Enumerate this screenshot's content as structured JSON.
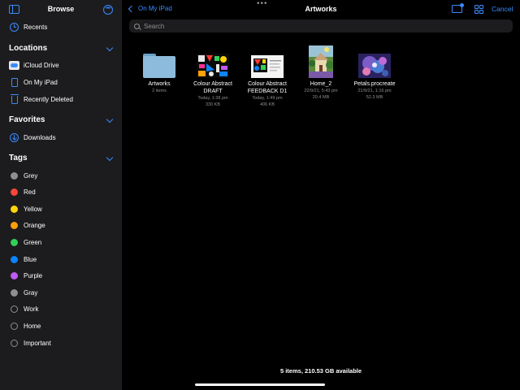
{
  "sidebar": {
    "title": "Browse",
    "recents": "Recents",
    "locations": {
      "header": "Locations",
      "items": [
        {
          "label": "iCloud Drive",
          "icon": "icloud-icon"
        },
        {
          "label": "On My iPad",
          "icon": "ipad-icon"
        },
        {
          "label": "Recently Deleted",
          "icon": "trash-icon"
        }
      ]
    },
    "favorites": {
      "header": "Favorites",
      "items": [
        {
          "label": "Downloads",
          "icon": "download-icon"
        }
      ]
    },
    "tags": {
      "header": "Tags",
      "items": [
        {
          "label": "Grey",
          "color": "#8e8e93"
        },
        {
          "label": "Red",
          "color": "#ff453a"
        },
        {
          "label": "Yellow",
          "color": "#ffd60a"
        },
        {
          "label": "Orange",
          "color": "#ff9f0a"
        },
        {
          "label": "Green",
          "color": "#30d158"
        },
        {
          "label": "Blue",
          "color": "#0a84ff"
        },
        {
          "label": "Purple",
          "color": "#bf5af2"
        },
        {
          "label": "Gray",
          "color": "#8e8e93"
        },
        {
          "label": "Work",
          "color": ""
        },
        {
          "label": "Home",
          "color": ""
        },
        {
          "label": "Important",
          "color": ""
        }
      ]
    }
  },
  "main": {
    "back_label": "On My iPad",
    "title": "Artworks",
    "cancel_label": "Cancel",
    "search_placeholder": "Search",
    "files": [
      {
        "name_line1": "Artworks",
        "name_line2": "",
        "meta1": "2 items",
        "meta2": "",
        "kind": "folder"
      },
      {
        "name_line1": "Colour Abstract",
        "name_line2": "DRAFT",
        "meta1": "Today, 1:38 pm",
        "meta2": "330 KB",
        "kind": "abstract-draft"
      },
      {
        "name_line1": "Colour Abstract",
        "name_line2": "FEEDBACK D1",
        "meta1": "Today, 1:49 pm",
        "meta2": "406 KB",
        "kind": "abstract-feedback"
      },
      {
        "name_line1": "Home_2",
        "name_line2": "",
        "meta1": "22/9/21, 5:43 pm",
        "meta2": "20.4 MB",
        "kind": "painting-home"
      },
      {
        "name_line1": "Petals.procreate",
        "name_line2": "",
        "meta1": "21/9/21, 1:16 pm",
        "meta2": "52.3 MB",
        "kind": "painting-petals"
      }
    ],
    "status": "5 items, 210.53 GB available"
  },
  "colors": {
    "accent": "#3a8bff",
    "sidebar_bg": "#1c1c1e",
    "background": "#000000"
  }
}
